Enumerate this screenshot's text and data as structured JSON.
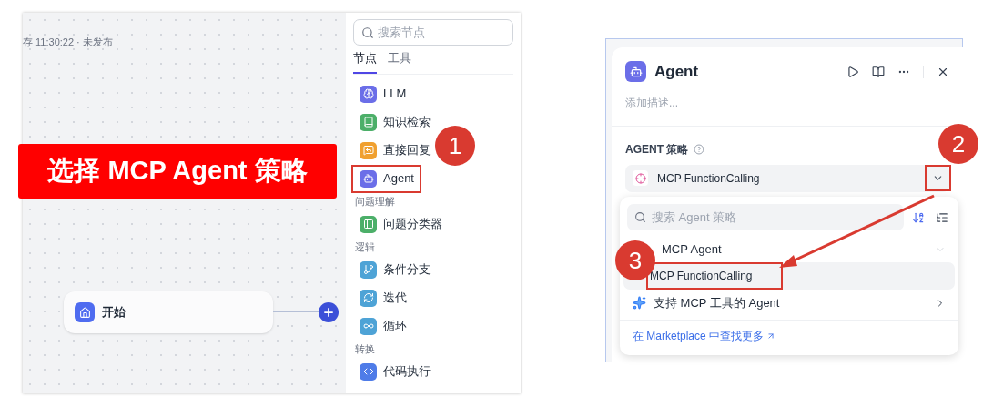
{
  "editor": {
    "save_status": "存 11:30:22 · 未发布",
    "start_node": {
      "label": "开始"
    },
    "node_panel": {
      "search": {
        "placeholder": "搜索节点"
      },
      "tabs": [
        {
          "label": "节点",
          "selected": true
        },
        {
          "label": "工具",
          "selected": false
        }
      ],
      "entries": [
        {
          "kind": "item",
          "label": "LLM",
          "color": "#6b6ee8",
          "highlighted": false
        },
        {
          "kind": "item",
          "label": "知识检索",
          "color": "#4caf69",
          "highlighted": false
        },
        {
          "kind": "item",
          "label": "直接回复",
          "color": "#f0a030",
          "highlighted": false
        },
        {
          "kind": "item",
          "label": "Agent",
          "color": "#6b6ee8",
          "highlighted": true
        },
        {
          "kind": "section",
          "label": "问题理解"
        },
        {
          "kind": "item",
          "label": "问题分类器",
          "color": "#4caf69",
          "highlighted": false
        },
        {
          "kind": "section",
          "label": "逻辑"
        },
        {
          "kind": "item",
          "label": "条件分支",
          "color": "#4ea3d6",
          "highlighted": false
        },
        {
          "kind": "item",
          "label": "迭代",
          "color": "#4ea3d6",
          "highlighted": false
        },
        {
          "kind": "item",
          "label": "循环",
          "color": "#4ea3d6",
          "highlighted": false
        },
        {
          "kind": "section",
          "label": "转换"
        },
        {
          "kind": "item",
          "label": "代码执行",
          "color": "#4f7ce8",
          "highlighted": false
        }
      ]
    }
  },
  "node_settings": {
    "title": "Agent",
    "description_placeholder": "添加描述...",
    "strategy_label": "AGENT 策略",
    "strategy_value": "MCP FunctionCalling",
    "chevron_highlighted": true,
    "dropdown": {
      "search": {
        "placeholder": "搜索 Agent 策略"
      },
      "groups": [
        {
          "label": "MCP Agent",
          "expanded": true,
          "children": [
            {
              "label": "MCP FunctionCalling",
              "selected": true,
              "highlighted": true
            }
          ]
        },
        {
          "label": "支持 MCP 工具的 Agent",
          "expanded": false
        }
      ],
      "footer_link": "在 Marketplace 中查找更多"
    }
  },
  "annotations": {
    "callout": "选择 MCP Agent 策略",
    "badges": [
      "1",
      "2",
      "3"
    ]
  }
}
